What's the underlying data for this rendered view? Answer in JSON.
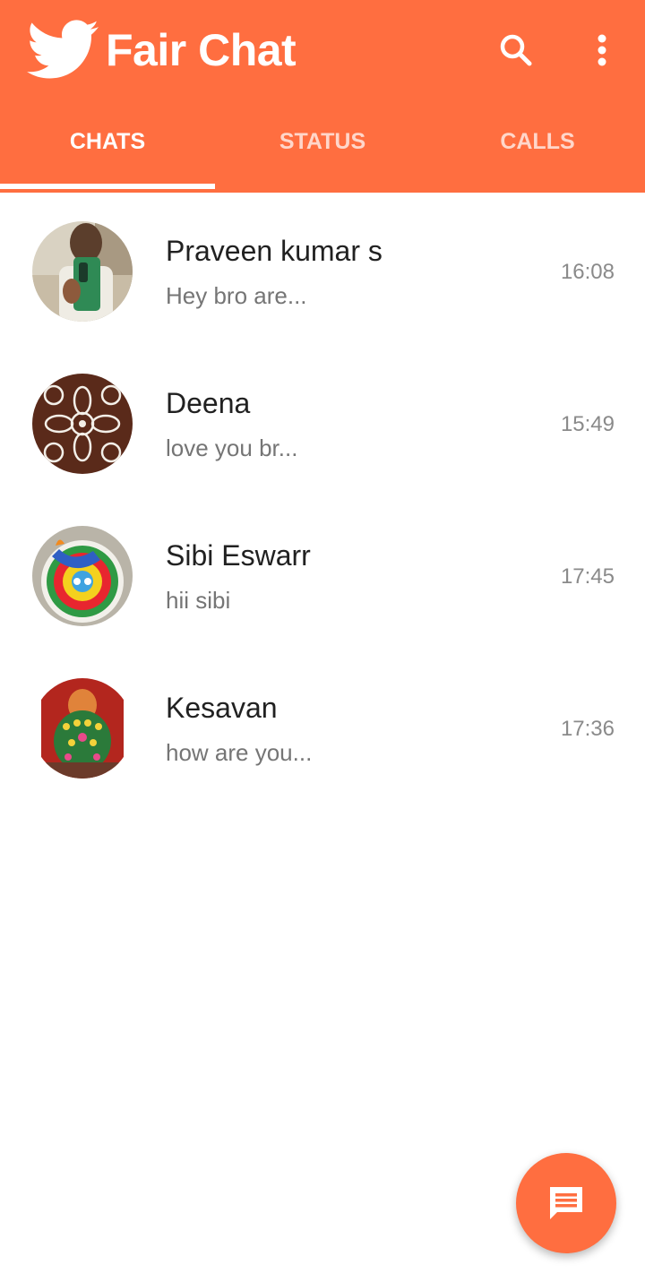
{
  "app": {
    "title": "Fair Chat",
    "brand_color": "#ff6e40",
    "logo_icon": "twitter-bird-icon"
  },
  "toolbar": {
    "search_icon": "search-icon",
    "more_icon": "more-vert-icon"
  },
  "tabs": [
    {
      "label": "CHATS",
      "active": true
    },
    {
      "label": "STATUS",
      "active": false
    },
    {
      "label": "CALLS",
      "active": false
    }
  ],
  "chats": [
    {
      "name": "Praveen kumar s",
      "message": "Hey bro are...",
      "time": "16:08"
    },
    {
      "name": "Deena",
      "message": "love you br...",
      "time": "15:49"
    },
    {
      "name": "Sibi Eswarr",
      "message": "hii sibi",
      "time": "17:45"
    },
    {
      "name": "Kesavan",
      "message": "how are you...",
      "time": "17:36"
    }
  ],
  "fab": {
    "icon": "message-icon"
  }
}
